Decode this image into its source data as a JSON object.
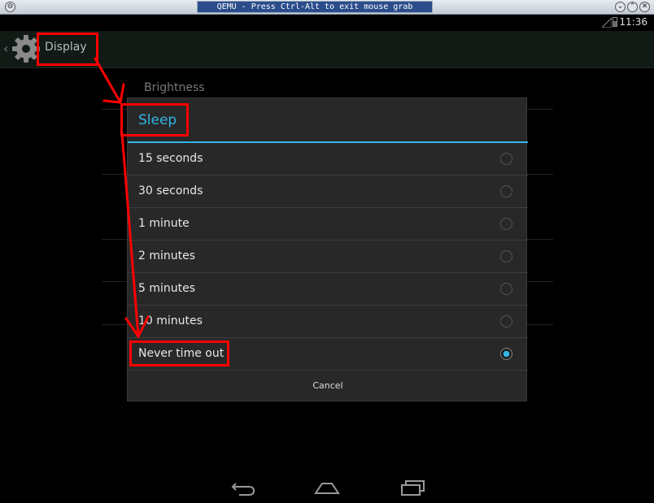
{
  "window": {
    "title": "QEMU - Press Ctrl-Alt to exit mouse grab",
    "menu_glyph": "⊖",
    "minimize_glyph": "⌄",
    "maximize_glyph": "⌃",
    "close_glyph": "✕"
  },
  "status_bar": {
    "time": "11:36"
  },
  "action_bar": {
    "title": "Display",
    "icon": "settings-gear-icon"
  },
  "settings_list": {
    "first_item": "Brightness"
  },
  "dialog": {
    "title": "Sleep",
    "options": [
      {
        "label": "15 seconds",
        "selected": false
      },
      {
        "label": "30 seconds",
        "selected": false
      },
      {
        "label": "1 minute",
        "selected": false
      },
      {
        "label": "2 minutes",
        "selected": false
      },
      {
        "label": "5 minutes",
        "selected": false
      },
      {
        "label": "10 minutes",
        "selected": false
      },
      {
        "label": "Never time out",
        "selected": true
      }
    ],
    "cancel_label": "Cancel"
  },
  "nav_bar": {
    "icons": [
      "back-icon",
      "home-icon",
      "recents-icon"
    ]
  },
  "colors": {
    "accent": "#33b5e5",
    "annotation": "#ff0000"
  }
}
